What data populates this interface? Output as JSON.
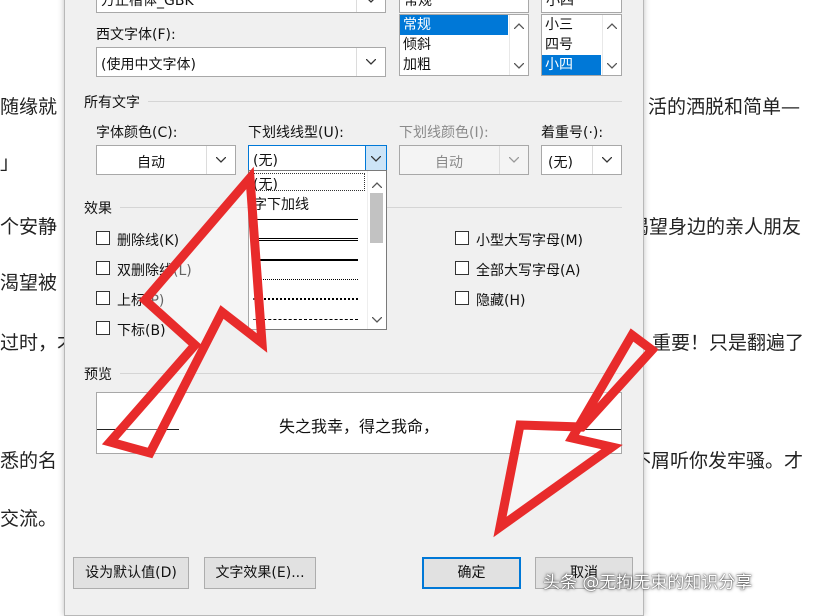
{
  "background_doc": {
    "lines": [
      {
        "left": "随缘就",
        "right": "活的洒脱和简单—"
      },
      {
        "left": "」",
        "right": ""
      },
      {
        "left": "个安静",
        "right": "渴望身边的亲人朋友"
      },
      {
        "left": "渴望被",
        "right": ""
      },
      {
        "left": "过时，才",
        "right": "重要！只是翻遍了"
      },
      {
        "left": "悉的名",
        "right": "不屑听你发牢骚。才"
      },
      {
        "left": "交流。",
        "right": ""
      }
    ]
  },
  "dialog": {
    "top_partial": {
      "font_value": "方正楷体_GBK",
      "style_value": "常规",
      "size_value": "小四"
    },
    "western_font": {
      "label": "西文字体(F):",
      "value": "(使用中文字体)"
    },
    "style_list": {
      "items": [
        "常规",
        "倾斜",
        "加粗"
      ],
      "selected": "常规"
    },
    "size_list": {
      "items": [
        "小三",
        "四号",
        "小四"
      ],
      "selected": "小四"
    },
    "all_text_section": "所有文字",
    "font_color": {
      "label": "字体颜色(C):",
      "value": "自动"
    },
    "underline_type": {
      "label": "下划线线型(U):",
      "value": "(无)"
    },
    "underline_color": {
      "label": "下划线颜色(I):",
      "value": "自动"
    },
    "emphasis": {
      "label": "着重号(·):",
      "value": "(无)"
    },
    "underline_options": {
      "items": [
        "(无)",
        "字下加线"
      ]
    },
    "effects_section": "效果",
    "effects_left": [
      "删除线(K)",
      "双删除线(L)",
      "上标(P)",
      "下标(B)"
    ],
    "effects_right": [
      "小型大写字母(M)",
      "全部大写字母(A)",
      "隐藏(H)"
    ],
    "preview_section": "预览",
    "preview_text": "失之我幸，得之我命，",
    "buttons": {
      "set_default": "设为默认值(D)",
      "text_effects": "文字效果(E)...",
      "ok": "确定",
      "cancel": "取消"
    }
  },
  "watermark": "头条 @无拘无束的知识分享",
  "colors": {
    "arrow": "#e82b2b",
    "selection": "#0078d7",
    "dialog_bg": "#f0f0f0"
  }
}
